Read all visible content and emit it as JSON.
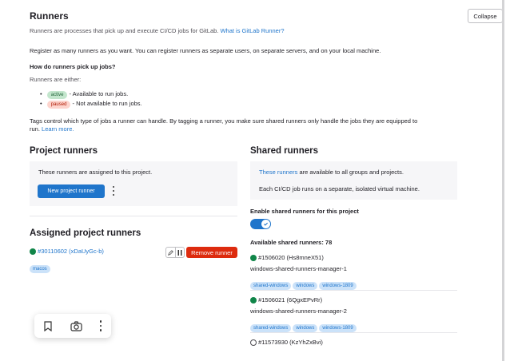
{
  "header": {
    "title": "Runners",
    "collapse_label": "Collapse",
    "intro": "Runners are processes that pick up and execute CI/CD jobs for GitLab.",
    "intro_link": "What is GitLab Runner?",
    "register": "Register as many runners as you want. You can register runners as separate users, on separate servers, and on your local machine.",
    "how_title": "How do runners pick up jobs?",
    "either": "Runners are either:",
    "active_badge": "active",
    "active_text": "- Available to run jobs.",
    "paused_badge": "paused",
    "paused_text": "- Not available to run jobs.",
    "tags_text_1": "Tags control which type of jobs a runner can handle. By tagging a runner, you make sure shared runners only handle the jobs they are equipped to",
    "tags_text_2": "run.",
    "learn_more": "Learn more."
  },
  "project_runners": {
    "title": "Project runners",
    "panel_text": "These runners are assigned to this project.",
    "new_button": "New project runner",
    "more_icon": "more-vertical-icon",
    "assigned_title": "Assigned project runners",
    "runner_name": "#30110602 (xDaUyGc-b)",
    "runner_tag": "macos",
    "remove_button": "Remove runner"
  },
  "shared_runners": {
    "title": "Shared runners",
    "panel_link": "These runners",
    "panel_text": " are available to all groups and projects.",
    "panel_text_2": "Each CI/CD job runs on a separate, isolated virtual machine.",
    "enable_label": "Enable shared runners for this project",
    "available": "Available shared runners: 78",
    "runners": [
      {
        "name": "#1506020 (Hs8mneX51)",
        "desc": "windows-shared-runners-manager-1",
        "tags": [
          "shared-windows",
          "windows",
          "windows-1809"
        ]
      },
      {
        "name": "#1506021 (6QgxEPvRr)",
        "desc": "windows-shared-runners-manager-2",
        "tags": [
          "shared-windows",
          "windows",
          "windows-1809"
        ]
      },
      {
        "name": "#11573930 (KzYhZxBvi)"
      }
    ]
  },
  "colors": {
    "accent": "#1f75cb",
    "danger": "#dd2b0e",
    "online": "#108548"
  }
}
